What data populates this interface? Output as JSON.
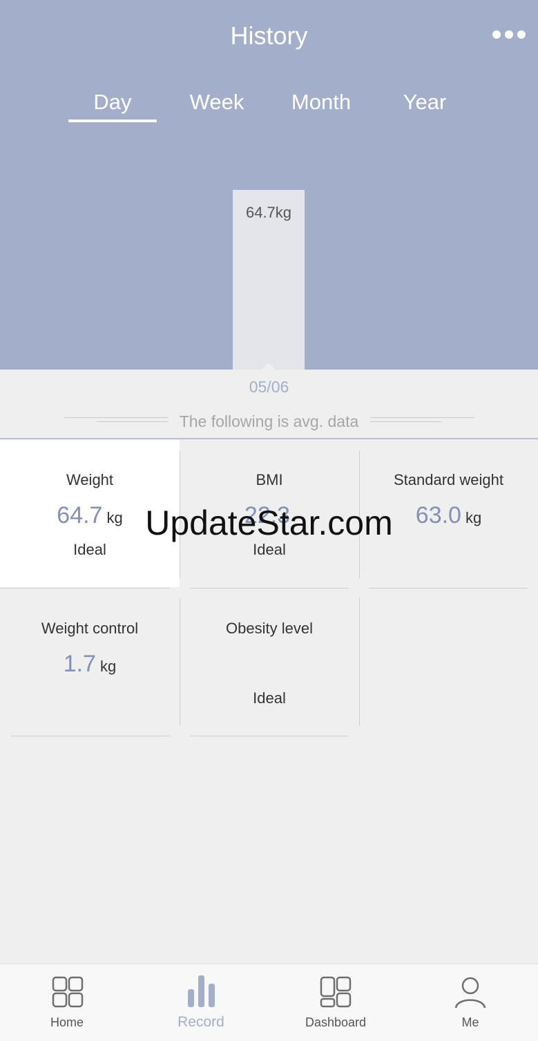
{
  "header": {
    "title": "History",
    "more_icon": "more-dots-icon",
    "tabs": [
      "Day",
      "Week",
      "Month",
      "Year"
    ],
    "active_tab": "Day"
  },
  "chart_data": {
    "type": "bar",
    "categories": [
      "05/06"
    ],
    "values": [
      64.7
    ],
    "data_labels": [
      "64.7kg"
    ],
    "xlabel": "",
    "ylabel": ""
  },
  "summary": {
    "date": "05/06",
    "note": "The following is avg. data"
  },
  "metrics": [
    {
      "label": "Weight",
      "value": "64.7",
      "unit": "kg",
      "status": "Ideal"
    },
    {
      "label": "BMI",
      "value": "22.3",
      "unit": "",
      "status": "Ideal"
    },
    {
      "label": "Standard weight",
      "value": "63.0",
      "unit": "kg",
      "status": ""
    },
    {
      "label": "Weight control",
      "value": "1.7",
      "unit": "kg",
      "status": ""
    },
    {
      "label": "Obesity level",
      "value": "",
      "unit": "",
      "status": "Ideal"
    }
  ],
  "watermark": "UpdateStar.com",
  "nav": {
    "items": [
      {
        "label": "Home",
        "icon": "home-grid-icon"
      },
      {
        "label": "Record",
        "icon": "bar-chart-icon"
      },
      {
        "label": "Dashboard",
        "icon": "dashboard-icon"
      },
      {
        "label": "Me",
        "icon": "person-icon"
      }
    ],
    "active": "Record"
  },
  "colors": {
    "header_bg": "#a3aecb",
    "accent": "#8490b6",
    "page_bg": "#efefef"
  }
}
